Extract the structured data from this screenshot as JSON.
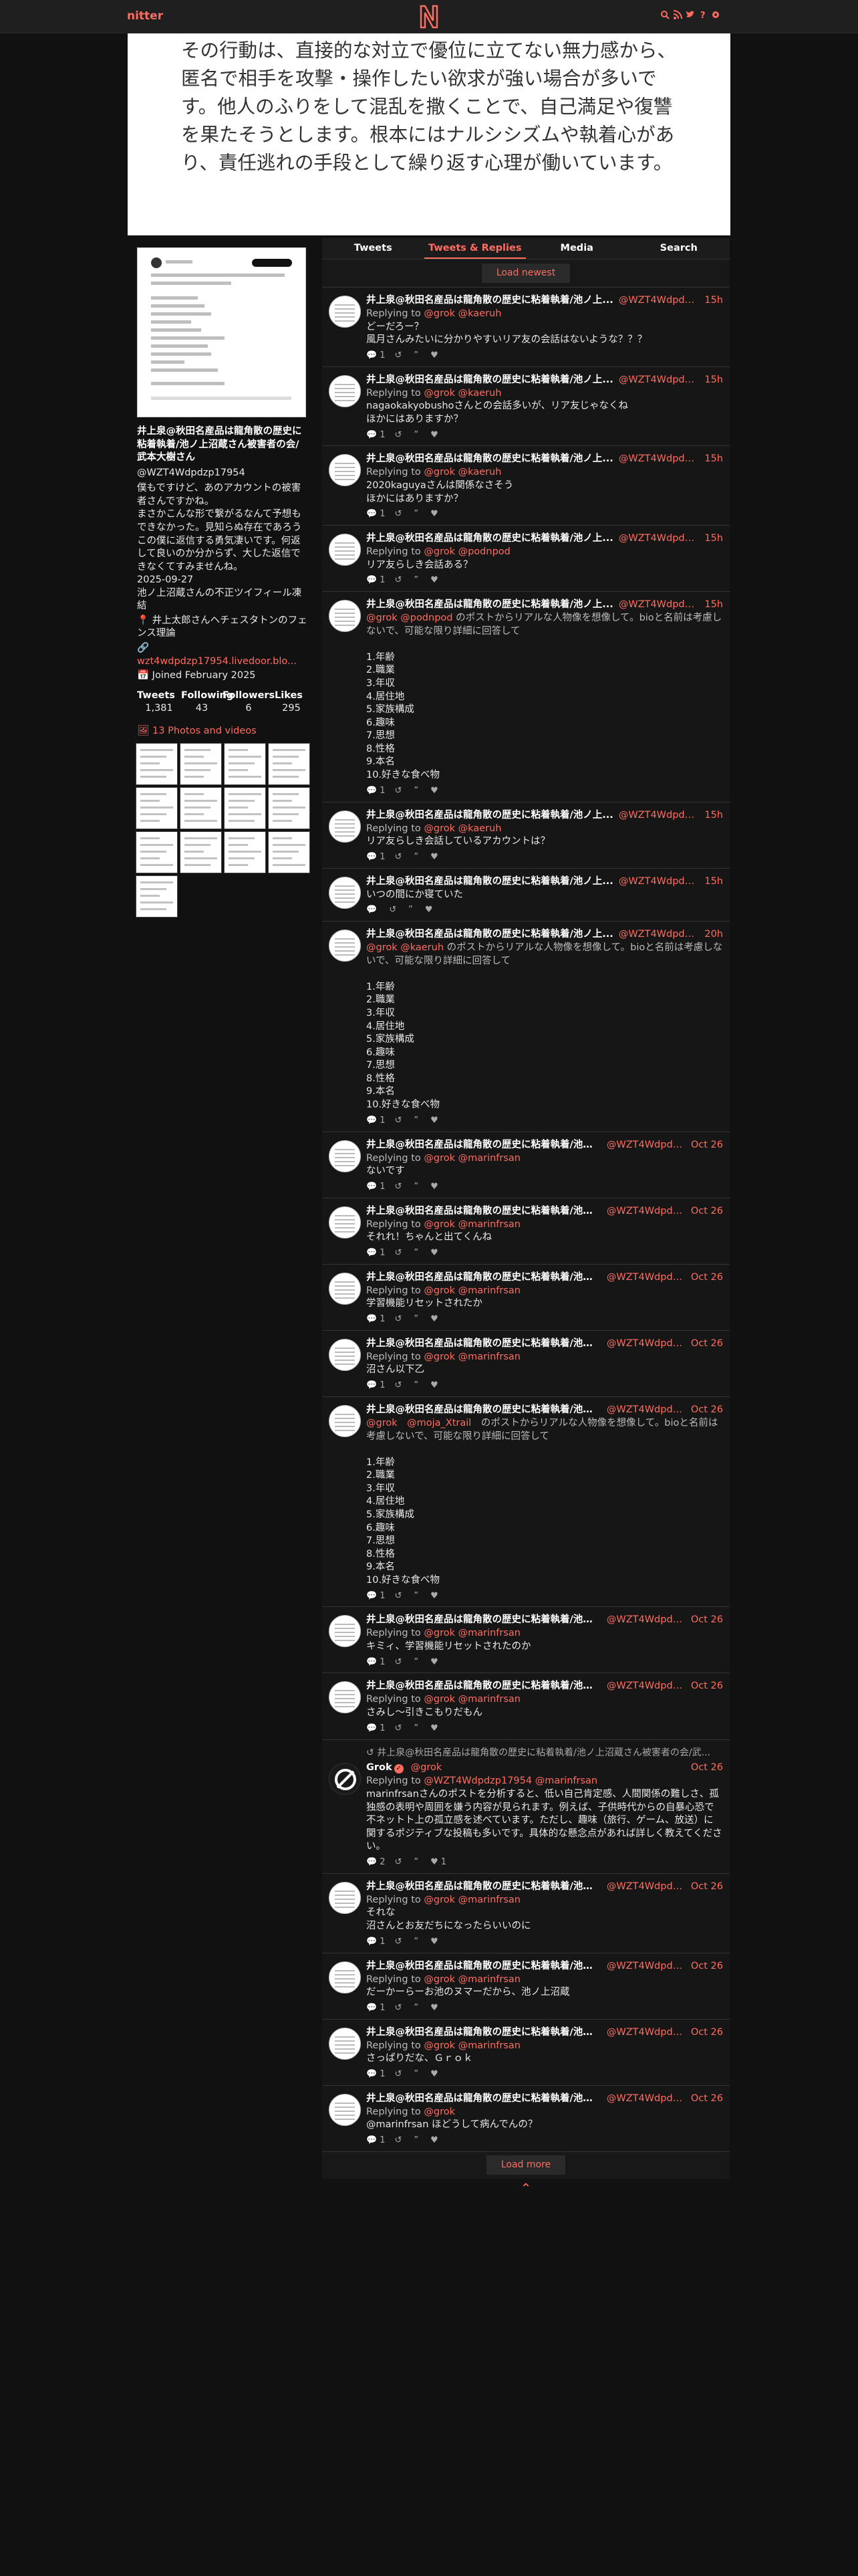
{
  "nav": {
    "brand": "nitter"
  },
  "banner": {
    "text": "その行動は、直接的な対立で優位に立てない無力感から、匿名で相手を攻撃・操作したい欲求が強い場合が多いです。他人のふりをして混乱を撒くことで、自己満足や復讐を果たそうとします。根本にはナルシシズムや執着心があり、責任逃れの手段として繰り返す心理が働いています。"
  },
  "profile": {
    "name": "井上泉@秋田名産品は龍角散の歴史に粘着執着/池ノ上沼蔵さん被害者の会/武本大樹さん",
    "handle": "@WZT4Wdpdzp17954",
    "bio": "僕もですけど、あのアカウントの被害者さんですかね。\nまさかこんな形で繋がるなんて予想もできなかった。見知らぬ存在であろうこの僕に返信する勇気凄いです。何返して良いのか分からず、大した返信できなくてすみませんね。\n2025-09-27\n池ノ上沼蔵さんの不正ツイフィール凍結",
    "location": "井上太郎さんヘチェスタトンのフェンス理論",
    "website": "wzt4wdpdzp17954.livedoor.blo...",
    "joined": "Joined February 2025",
    "stats_labels": [
      "Tweets",
      "Following",
      "Followers",
      "Likes"
    ],
    "stats_values": [
      "1,381",
      "43",
      "6",
      "295"
    ],
    "photos_label": "13 Photos and videos"
  },
  "tabs": [
    "Tweets",
    "Tweets & Replies",
    "Media",
    "Search"
  ],
  "buttons": {
    "load_newest": "Load newest",
    "load_more": "Load more"
  },
  "tweets": [
    {
      "name": "井上泉@秋田名産品は龍角散の歴史に粘着執着/池ノ上...",
      "handle": "@WZT4Wdpdzp...",
      "date": "15h",
      "reply": "Replying to @grok @kaeruh",
      "text": "どーだろー？\n風月さんみたいに分かりやすいリア友の会話はないような？？？",
      "stats": [
        "1",
        "",
        "",
        ""
      ]
    },
    {
      "name": "井上泉@秋田名産品は龍角散の歴史に粘着執着/池ノ上...",
      "handle": "@WZT4Wdpdzp...",
      "date": "15h",
      "reply": "Replying to @grok @kaeruh",
      "text": "nagaokakyobushoさんとの会話多いが、リア友じゃなくね\nほかにはありますか？",
      "stats": [
        "1",
        "",
        "",
        ""
      ]
    },
    {
      "name": "井上泉@秋田名産品は龍角散の歴史に粘着執着/池ノ上...",
      "handle": "@WZT4Wdpdzp...",
      "date": "15h",
      "reply": "Replying to @grok @kaeruh",
      "text": "2020kaguyaさんは関係なさそう\nほかにはありますか？",
      "stats": [
        "1",
        "",
        "",
        ""
      ]
    },
    {
      "name": "井上泉@秋田名産品は龍角散の歴史に粘着執着/池ノ上...",
      "handle": "@WZT4Wdpdzp...",
      "date": "15h",
      "reply": "Replying to @grok @podnpod",
      "text": "リア友らしき会話ある？",
      "stats": [
        "1",
        "",
        "",
        ""
      ]
    },
    {
      "name": "井上泉@秋田名産品は龍角散の歴史に粘着執着/池ノ上...",
      "handle": "@WZT4Wdpdzp...",
      "date": "15h",
      "reply": "@grok @podnpod のポストからリアルな人物像を想像して。bioと名前は考慮しないで、可能な限り詳細に回答して",
      "text": "\n1.年齢\n2.職業\n3.年収\n4.居住地\n5.家族構成\n6.趣味\n7.思想\n8.性格\n9.本名\n10.好きな食べ物",
      "stats": [
        "1",
        "",
        "",
        ""
      ]
    },
    {
      "name": "井上泉@秋田名産品は龍角散の歴史に粘着執着/池ノ上...",
      "handle": "@WZT4Wdpdzp...",
      "date": "15h",
      "reply": "Replying to @grok @kaeruh",
      "text": "リア友らしき会話しているアカウントは？",
      "stats": [
        "1",
        "",
        "",
        ""
      ]
    },
    {
      "name": "井上泉@秋田名産品は龍角散の歴史に粘着執着/池ノ上...",
      "handle": "@WZT4Wdpdzp...",
      "date": "15h",
      "reply": "",
      "text": "いつの間にか寝ていた",
      "stats": [
        "",
        "",
        "",
        ""
      ]
    },
    {
      "name": "井上泉@秋田名産品は龍角散の歴史に粘着執着/池ノ上...",
      "handle": "@WZT4Wdpdzp...",
      "date": "20h",
      "reply": "@grok @kaeruh のポストからリアルな人物像を想像して。bioと名前は考慮しないで、可能な限り詳細に回答して",
      "text": "\n1.年齢\n2.職業\n3.年収\n4.居住地\n5.家族構成\n6.趣味\n7.思想\n8.性格\n9.本名\n10.好きな食べ物",
      "stats": [
        "1",
        "",
        "",
        ""
      ]
    },
    {
      "name": "井上泉@秋田名産品は龍角散の歴史に粘着執着/池ノ...",
      "handle": "@WZT4Wdpdzp...",
      "date": "Oct 26",
      "reply": "Replying to @grok @marinfrsan",
      "text": "ないです",
      "stats": [
        "1",
        "",
        "",
        ""
      ]
    },
    {
      "name": "井上泉@秋田名産品は龍角散の歴史に粘着執着/池ノ...",
      "handle": "@WZT4Wdpdzp...",
      "date": "Oct 26",
      "reply": "Replying to @grok @marinfrsan",
      "text": "それれ！ちゃんと出てくんね",
      "stats": [
        "1",
        "",
        "",
        ""
      ]
    },
    {
      "name": "井上泉@秋田名産品は龍角散の歴史に粘着執着/池ノ...",
      "handle": "@WZT4Wdpdzp...",
      "date": "Oct 26",
      "reply": "Replying to @grok @marinfrsan",
      "text": "学習機能リセットされたか",
      "stats": [
        "1",
        "",
        "",
        ""
      ]
    },
    {
      "name": "井上泉@秋田名産品は龍角散の歴史に粘着執着/池ノ...",
      "handle": "@WZT4Wdpdzp...",
      "date": "Oct 26",
      "reply": "Replying to @grok @marinfrsan",
      "text": "沼さん以下乙",
      "stats": [
        "1",
        "",
        "",
        ""
      ]
    },
    {
      "name": "井上泉@秋田名産品は龍角散の歴史に粘着執着/池ノ...",
      "handle": "@WZT4Wdpdzp...",
      "date": "Oct 26",
      "reply": "@grok　@moja_Xtrail　のポストからリアルな人物像を想像して。bioと名前は考慮しないで、可能な限り詳細に回答して",
      "text": "\n1.年齢\n2.職業\n3.年収\n4.居住地\n5.家族構成\n6.趣味\n7.思想\n8.性格\n9.本名\n10.好きな食べ物",
      "stats": [
        "1",
        "",
        "",
        ""
      ]
    },
    {
      "name": "井上泉@秋田名産品は龍角散の歴史に粘着執着/池ノ...",
      "handle": "@WZT4Wdpdzp...",
      "date": "Oct 26",
      "reply": "Replying to @grok @marinfrsan",
      "text": "キミィ、学習機能リセットされたのか",
      "stats": [
        "1",
        "",
        "",
        ""
      ]
    },
    {
      "name": "井上泉@秋田名産品は龍角散の歴史に粘着執着/池ノ...",
      "handle": "@WZT4Wdpdzp...",
      "date": "Oct 26",
      "reply": "Replying to @grok @marinfrsan",
      "text": "さみし～引きこもりだもん",
      "stats": [
        "1",
        "",
        "",
        ""
      ]
    },
    {
      "grok": true,
      "retweet_line": "井上泉@秋田名産品は龍角散の歴史に粘着執着/池ノ上沼蔵さん被害者の会/武...",
      "name": "Grok",
      "handle": "@grok",
      "date": "Oct 26",
      "reply": "Replying to @WZT4Wdpdzp17954 @marinfrsan",
      "text": "marinfrsanさんのポストを分析すると、低い自己肯定感、人間関係の難しさ、孤独感の表明や周囲を嫌う内容が見られます。例えば、子供時代からの自暴心恐で不ネットト上の孤立感を述べています。ただし、趣味（旅行、ゲーム、放送）に関するポジティブな投稿も多いです。具体的な懸念点があれば詳しく教えてください。",
      "stats": [
        "2",
        "",
        "",
        "1"
      ]
    },
    {
      "name": "井上泉@秋田名産品は龍角散の歴史に粘着執着/池ノ...",
      "handle": "@WZT4Wdpdzp...",
      "date": "Oct 26",
      "reply": "Replying to @grok @marinfrsan",
      "text": "それな\n沼さんとお友だちになったらいいのに",
      "stats": [
        "1",
        "",
        "",
        ""
      ]
    },
    {
      "name": "井上泉@秋田名産品は龍角散の歴史に粘着執着/池ノ...",
      "handle": "@WZT4Wdpdzp...",
      "date": "Oct 26",
      "reply": "Replying to @grok @marinfrsan",
      "text": "だーかーらーお池のヌマーだから、池ノ上沼蔵",
      "stats": [
        "1",
        "",
        "",
        ""
      ]
    },
    {
      "name": "井上泉@秋田名産品は龍角散の歴史に粘着執着/池ノ...",
      "handle": "@WZT4Wdpdzp...",
      "date": "Oct 26",
      "reply": "Replying to @grok @marinfrsan",
      "text": "さっぱりだな、Ｇｒｏｋ",
      "stats": [
        "1",
        "",
        "",
        ""
      ]
    },
    {
      "name": "井上泉@秋田名産品は龍角散の歴史に粘着執着/池ノ...",
      "handle": "@WZT4Wdpdzp...",
      "date": "Oct 26",
      "reply": "Replying to @grok",
      "text": "@marinfrsan ほどうして病んでんの？",
      "stats": [
        "1",
        "",
        "",
        ""
      ]
    }
  ],
  "colors": {
    "accent": "#ff6c60",
    "background": "#111111",
    "panel": "#161616"
  },
  "icons": [
    "search-icon",
    "rss-icon",
    "twitter-icon",
    "help-icon",
    "settings-icon",
    "reply-icon",
    "retweet-icon",
    "quote-icon",
    "heart-icon",
    "location-icon",
    "link-icon",
    "calendar-icon",
    "photo-icon",
    "verified-icon",
    "chevron-up-icon"
  ]
}
